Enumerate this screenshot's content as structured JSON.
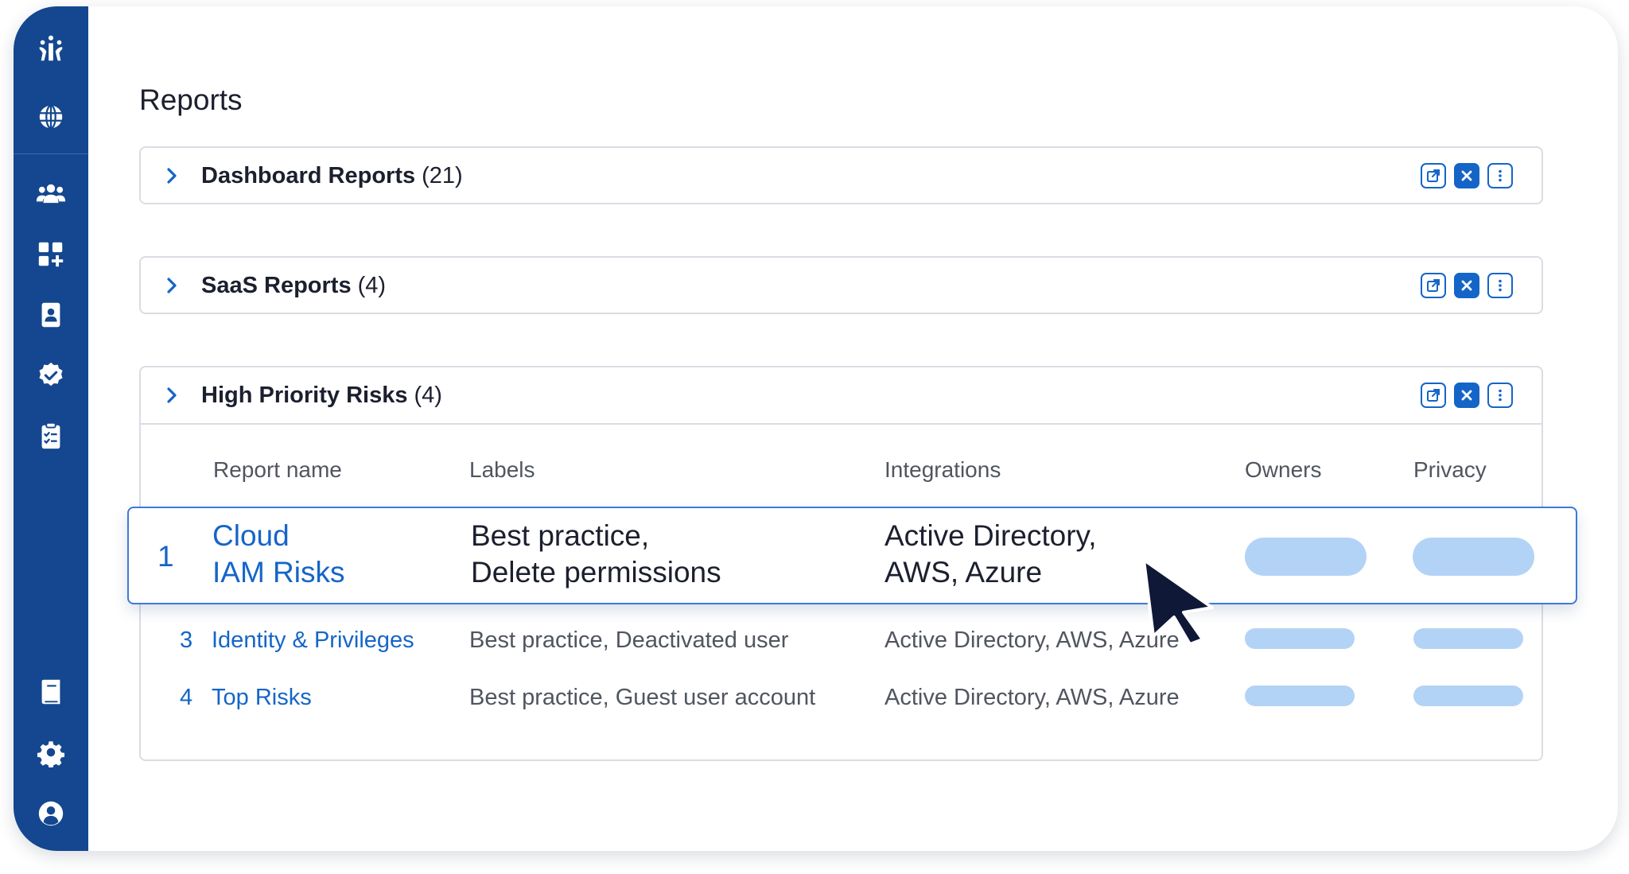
{
  "page_title": "Reports",
  "sidebar": {
    "items": [
      {
        "name": "logo",
        "icon": "brand-logo-icon"
      },
      {
        "name": "globe",
        "icon": "globe-icon"
      },
      {
        "name": "users",
        "icon": "users-icon"
      },
      {
        "name": "apps",
        "icon": "apps-add-icon"
      },
      {
        "name": "identity",
        "icon": "id-badge-icon"
      },
      {
        "name": "verified",
        "icon": "verified-badge-icon"
      },
      {
        "name": "checklist",
        "icon": "clipboard-checklist-icon"
      },
      {
        "name": "docs",
        "icon": "book-icon"
      },
      {
        "name": "settings",
        "icon": "gear-icon"
      },
      {
        "name": "profile",
        "icon": "user-circle-icon"
      }
    ]
  },
  "panels": [
    {
      "name": "Dashboard Reports",
      "count": "(21)"
    },
    {
      "name": "SaaS Reports",
      "count": "(4)"
    },
    {
      "name": "High Priority Risks",
      "count": "(4)"
    }
  ],
  "table": {
    "headers": {
      "report_name": "Report name",
      "labels": "Labels",
      "integrations": "Integrations",
      "owners": "Owners",
      "privacy": "Privacy"
    },
    "rows": [
      {
        "num": "1",
        "name_line1": "Cloud",
        "name_line2": "IAM Risks",
        "labels_line1": "Best practice,",
        "labels_line2": "Delete permissions",
        "integrations_line1": "Active Directory,",
        "integrations_line2": "AWS, Azure"
      },
      {
        "num": "3",
        "name": "Identity & Privileges",
        "labels": "Best practice, Deactivated user",
        "integrations": "Active Directory, AWS, Azure"
      },
      {
        "num": "4",
        "name": "Top Risks",
        "labels": "Best practice, Guest user account",
        "integrations": "Active Directory, AWS, Azure"
      }
    ]
  },
  "colors": {
    "sidebar": "#14478f",
    "accent": "#1565c8",
    "pill": "#b3d3f6",
    "border": "#dadde3"
  }
}
